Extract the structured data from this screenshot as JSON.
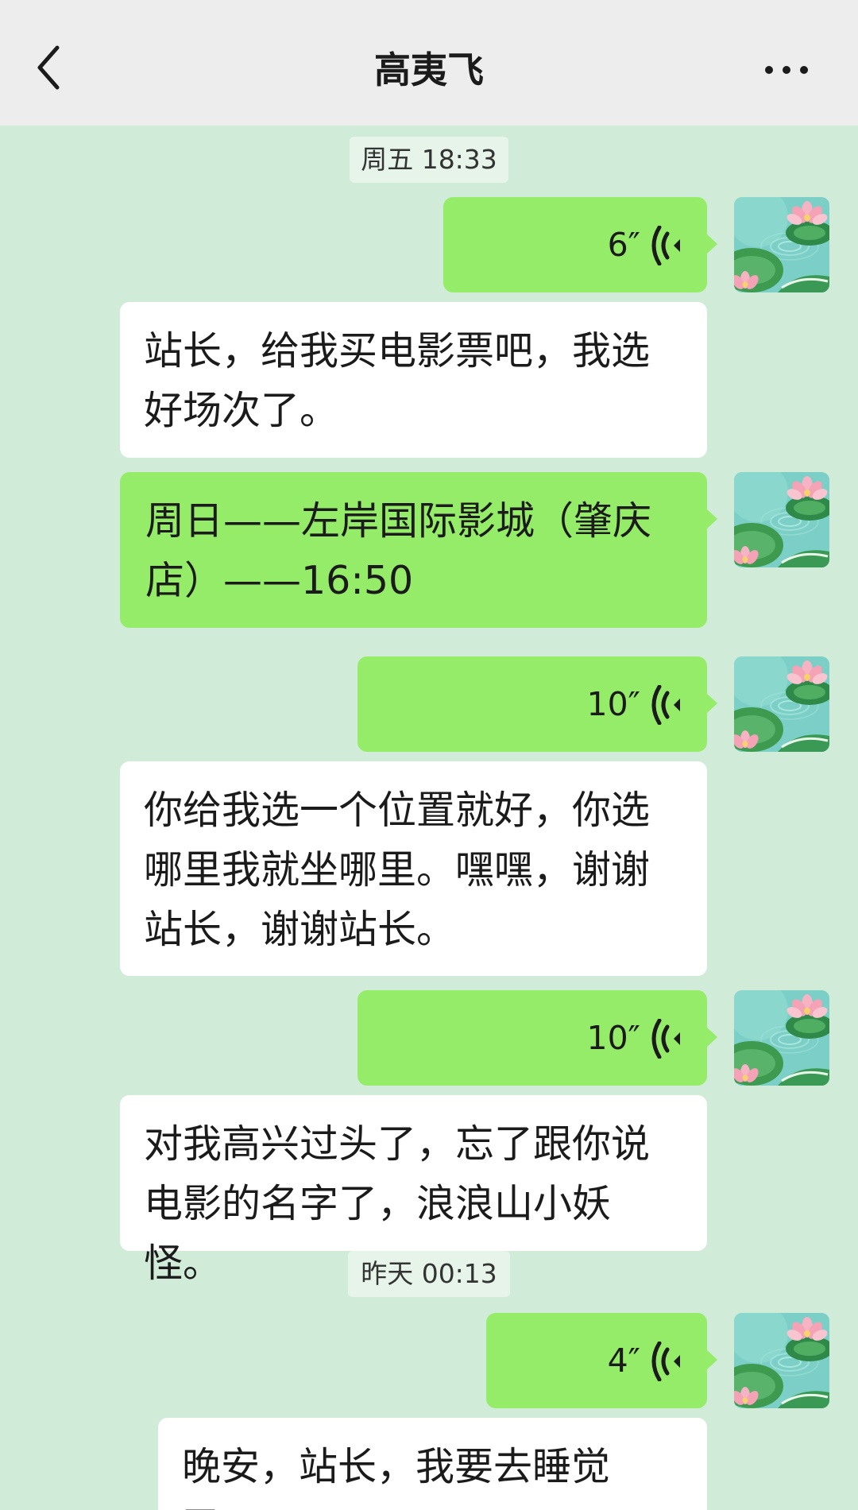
{
  "header": {
    "title": "高夷飞"
  },
  "icons": {
    "back": "chevron-left-icon",
    "more": "more-dots-icon",
    "voice": "voice-wave-icon"
  },
  "colors": {
    "sent_bubble": "#95ec69",
    "received_bubble": "#ffffff",
    "chat_background": "#d0ecd9",
    "header_background": "#ededed"
  },
  "messages": {
    "time_1": "周五 18:33",
    "voice_1_duration": "6″",
    "text_1": "站长，给我买电影票吧，我选好场次了。",
    "text_2": "周日——左岸国际影城（肇庆店）——16:50",
    "voice_2_duration": "10″",
    "text_3": "你给我选一个位置就好，你选哪里我就坐哪里。嘿嘿，谢谢站长，谢谢站长。",
    "voice_3_duration": "10″",
    "text_4": "对我高兴过头了，忘了跟你说电影的名字了，浪浪山小妖怪。",
    "time_2": "昨天 00:13",
    "voice_4_duration": "4″",
    "text_5": "晚安，站长，我要去睡觉了。"
  }
}
